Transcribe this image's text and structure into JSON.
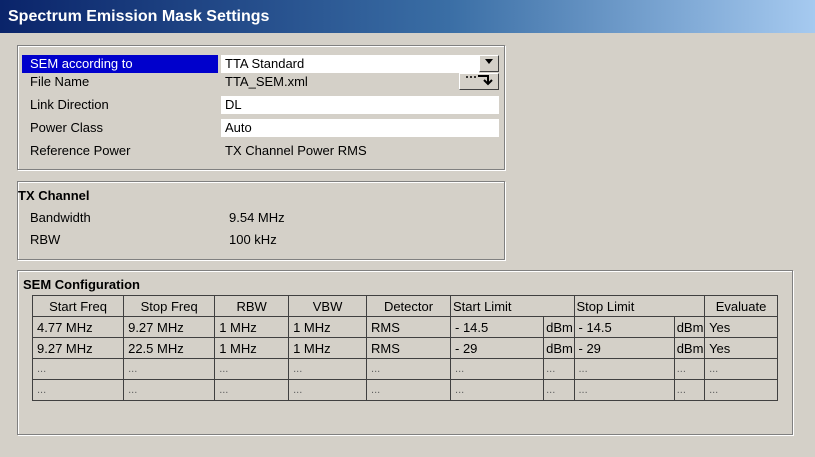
{
  "window": {
    "title": "Spectrum Emission Mask Settings"
  },
  "settings": {
    "sem_according_to": {
      "label": "SEM according to",
      "value": "TTA Standard"
    },
    "file_name": {
      "label": "File Name",
      "value": "TTA_SEM.xml"
    },
    "link_direction": {
      "label": "Link Direction",
      "value": "DL"
    },
    "power_class": {
      "label": "Power Class",
      "value": "Auto"
    },
    "reference_power": {
      "label": "Reference Power",
      "value": "TX Channel Power RMS"
    }
  },
  "tx_channel": {
    "title": "TX Channel",
    "bandwidth": {
      "label": "Bandwidth",
      "value": "9.54 MHz"
    },
    "rbw": {
      "label": "RBW",
      "value": "100 kHz"
    }
  },
  "sem_config": {
    "title": "SEM Configuration",
    "headers": [
      "Start Freq",
      "Stop Freq",
      "RBW",
      "VBW",
      "Detector",
      "Start Limit",
      "Stop Limit",
      "Evaluate"
    ],
    "rows": [
      [
        "4.77 MHz",
        "9.27 MHz",
        "1 MHz",
        "1 MHz",
        "RMS",
        "- 14.5",
        "dBm",
        "- 14.5",
        "dBm",
        "Yes"
      ],
      [
        "9.27 MHz",
        "22.5 MHz",
        "1 MHz",
        "1 MHz",
        "RMS",
        "- 29",
        "dBm",
        "- 29",
        "dBm",
        "Yes"
      ],
      [
        "...",
        "...",
        "...",
        "...",
        "...",
        "...",
        "...",
        "...",
        "...",
        "..."
      ],
      [
        "...",
        "...",
        "...",
        "...",
        "...",
        "...",
        "...",
        "...",
        "...",
        "..."
      ]
    ]
  },
  "icons": {
    "dropdown": "chevron-down-icon",
    "file_browse": "file-browse-icon"
  },
  "colors": {
    "selection": "#0000cc",
    "title_start": "#0a246a",
    "title_end": "#a6caf0",
    "background": "#d4d0c8"
  }
}
